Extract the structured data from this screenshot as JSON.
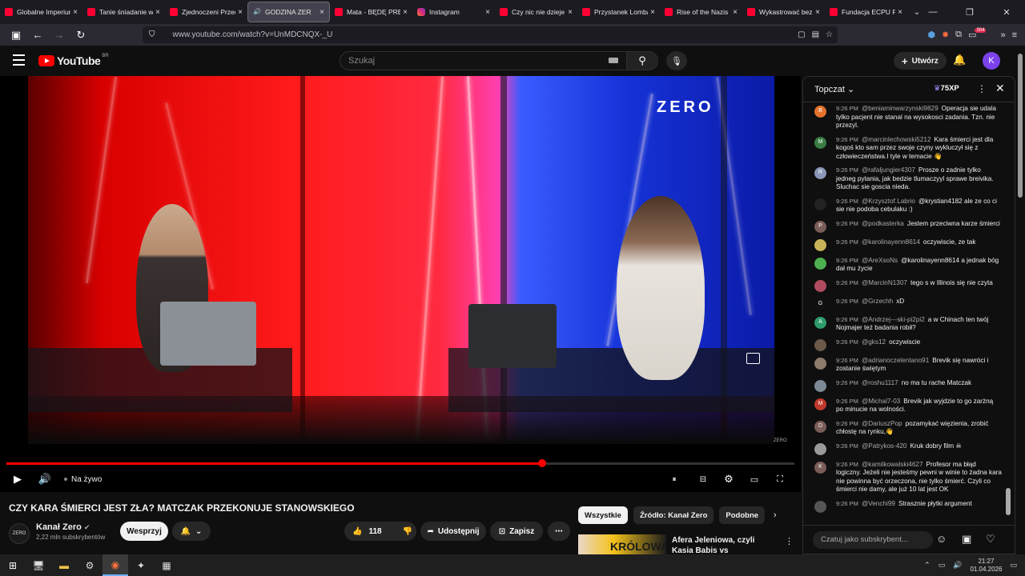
{
  "browser": {
    "tabs": [
      {
        "title": "Globalne Imperium",
        "icon": "youtube-icon",
        "active": false
      },
      {
        "title": "Tanie śniadanie w",
        "icon": "youtube-icon",
        "active": false
      },
      {
        "title": "Zjednoczeni Przec",
        "icon": "youtube-icon",
        "active": false
      },
      {
        "title": "GODZINA ZER",
        "icon": "speaker-icon",
        "active": true
      },
      {
        "title": "Mata - BĘDĘ PREZ",
        "icon": "youtube-icon",
        "active": false
      },
      {
        "title": "Instagram",
        "icon": "instagram-icon",
        "active": false
      },
      {
        "title": "Czy nic nie dzieje s",
        "icon": "youtube-icon",
        "active": false
      },
      {
        "title": "Przystanek Lomba",
        "icon": "youtube-icon",
        "active": false
      },
      {
        "title": "Rise of the Nazis a",
        "icon": "youtube-icon",
        "active": false
      },
      {
        "title": "Wykastrować bez",
        "icon": "youtube-icon",
        "active": false
      },
      {
        "title": "Fundacja ECPU Po",
        "icon": "youtube-icon",
        "active": false
      }
    ],
    "url": "www.youtube.com/watch?v=UnMDCNQX-_U",
    "extension_badge": "304"
  },
  "youtube": {
    "logo_text": "YouTube",
    "logo_region": "BR",
    "search_placeholder": "Szukaj",
    "create_label": "Utwórz",
    "avatar_letter": "K"
  },
  "video": {
    "overlay_logo": "ZERO",
    "corner_logo": "ZERO",
    "live_label": "Na żywo",
    "progress": 0.68,
    "title": "CZY KARA ŚMIERCI JEST ZŁA? MATCZAK PRZEKONUJE STANOWSKIEGO",
    "channel": {
      "name": "Kanał Zero",
      "subscribers": "2,22 mln subskrybentów",
      "avatar_text": "ZERO"
    },
    "support_label": "Wesprzyj",
    "likes": "118",
    "share_label": "Udostępnij",
    "save_label": "Zapisz"
  },
  "related": {
    "chips": [
      "Wszystkie",
      "Źródło: Kanał Zero",
      "Podobne"
    ],
    "first_item": {
      "thumb_text": "KRÓLOWA",
      "title": "Afera Jeleniowa, czyli Kasia Babis vs BezSchematu vs ..."
    }
  },
  "chat": {
    "mode_label": "Topczat",
    "xp_label": "75XP",
    "input_placeholder": "Czatuj jako subskrybent...",
    "messages": [
      {
        "time": "9:26 PM",
        "author": "@beniaminwarzynski9829",
        "text": "Operacja sie udala tylko pacjent nie stanal na wysokosci zadania. Tzn. nie przezyl.",
        "avatar": "B",
        "color": "#e4722c"
      },
      {
        "time": "9:26 PM",
        "author": "@marcinlechowski5212",
        "text": "Kara śmierci jest dla kogoś kto sam przez swoje czyny wykluczył się z człowieczeństwa.I tyle w temacie 👋",
        "avatar": "M",
        "color": "#3a7d44"
      },
      {
        "time": "9:26 PM",
        "author": "@rafaljungier4307",
        "text": "Prosze o zadnie tylko jedneg pytania, jak bedzie tlumaczyyl sprawe breivika. Sluchac sie goscia nieda.",
        "avatar": "R",
        "color": "#8a96b5"
      },
      {
        "time": "9:26 PM",
        "author": "@Krzysztof.Labrio",
        "text": "@krystian4182 ale ze co ci sie nie podoba cebulaku :)",
        "avatar": "",
        "color": "#222"
      },
      {
        "time": "9:26 PM",
        "author": "@podkasterka",
        "text": "Jestem przeciwna karze śmierci",
        "avatar": "P",
        "color": "#7a5c58"
      },
      {
        "time": "9:26 PM",
        "author": "@karolinayenn8614",
        "text": "oczywiscie, ze tak",
        "avatar": "",
        "color": "#c9b35a"
      },
      {
        "time": "9:26 PM",
        "author": "@AreXsoNs",
        "text": "@karolinayenn8614 a jednak bóg dał mu życie",
        "avatar": "",
        "color": "#4caf50"
      },
      {
        "time": "9:26 PM",
        "author": "@MarcinN1307",
        "text": "tego s w Illinois się nie czyta",
        "avatar": "",
        "color": "#b04b5f"
      },
      {
        "time": "9:26 PM",
        "author": "@Grzechh",
        "text": "xD",
        "avatar": "G",
        "color": "#111"
      },
      {
        "time": "9:26 PM",
        "author": "@Andrzej---ski-pi2pi2",
        "text": "a w Chinach ten twój Nojmajer też badania robił?",
        "avatar": "A",
        "color": "#2e9b6a"
      },
      {
        "time": "9:26 PM",
        "author": "@gks12",
        "text": "oczywiscie",
        "avatar": "",
        "color": "#6b5a4a"
      },
      {
        "time": "9:26 PM",
        "author": "@adrianoczelentano91",
        "text": "Brevik się nawróci i zostanie świętym",
        "avatar": "",
        "color": "#8c7a6b"
      },
      {
        "time": "9:26 PM",
        "author": "@roshu1117",
        "text": "no ma tu rache Matczak",
        "avatar": "",
        "color": "#7d8a95"
      },
      {
        "time": "9:26 PM",
        "author": "@Michal7-03",
        "text": "Brevik jak wyjdzie to go zarżną po minucie na wolności.",
        "avatar": "M",
        "color": "#c0392b"
      },
      {
        "time": "9:26 PM",
        "author": "@DariuszPop",
        "text": "pozamykać więzienia, zrobić chłostę na rynku,👋",
        "avatar": "D",
        "color": "#7a5c58"
      },
      {
        "time": "9:26 PM",
        "author": "@Patrykos-420",
        "text": "Kruk dobry film ☠",
        "avatar": "",
        "color": "#9a9a9a"
      },
      {
        "time": "9:26 PM",
        "author": "@kamilkowalski4627",
        "text": "Profesor ma błąd logiczny. Jeżeli nie jesteśmy pewni w winie to żadna kara nie powinna być orzeczona, nie tylko śmierć. Czyli co śmierci nie damy, ale już 10 lat jest OK",
        "avatar": "K",
        "color": "#7a5c58"
      },
      {
        "time": "9:26 PM",
        "author": "@Venchi99",
        "text": "Strasznie płytki argument",
        "avatar": "",
        "color": "#555"
      }
    ]
  },
  "taskbar": {
    "time": "21:27",
    "date": "01.04.2026"
  },
  "colors": {
    "yt_red": "#ff0000",
    "bg": "#0f0f0f",
    "chip_selected": "#f1f1f1"
  }
}
